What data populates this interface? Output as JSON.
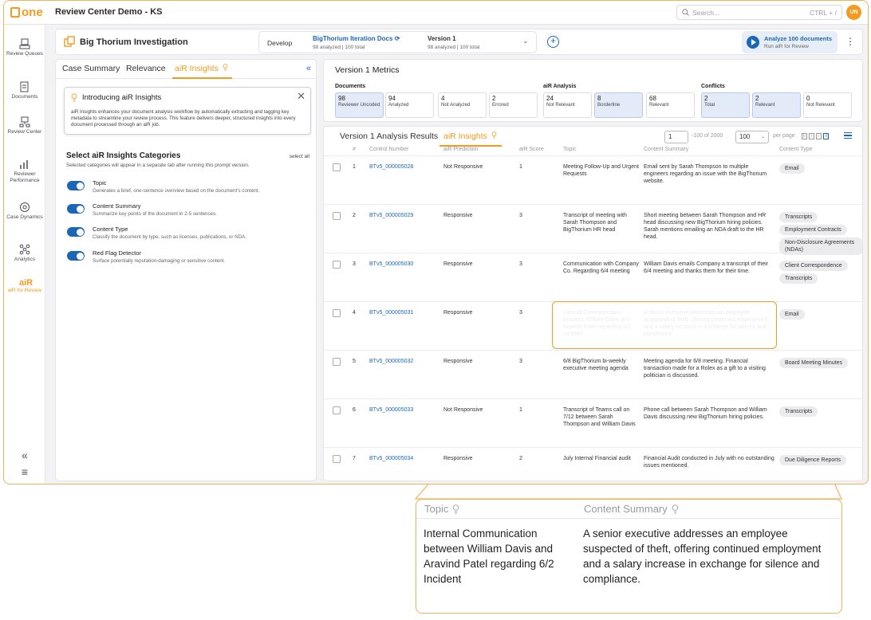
{
  "app": {
    "logo": "one",
    "title": "Review Center Demo - KS",
    "search_placeholder": "Search...",
    "search_shortcut": "CTRL + /",
    "avatar_initials": "UN"
  },
  "rail": [
    {
      "label": "Review Queues",
      "icon": "review-queues-icon"
    },
    {
      "label": "Documents",
      "icon": "documents-icon"
    },
    {
      "label": "Review Center",
      "icon": "review-center-icon"
    },
    {
      "label": "Reviewer Performance",
      "icon": "reviewer-performance-icon"
    },
    {
      "label": "Case Dynamics",
      "icon": "case-dynamics-icon"
    },
    {
      "label": "Analytics",
      "icon": "analytics-icon"
    },
    {
      "label": "aiR for Review",
      "icon": "air-icon"
    }
  ],
  "case": {
    "title": "Big Thorium Investigation",
    "env_label": "Develop",
    "prompt_link": "BigThorium Iteration Docs",
    "prompt_sub": "98 analyzed | 100 total",
    "version": "Version 1",
    "version_sub": "98 analyzed | 100 total",
    "analyze_label": "Analyze 100 documents",
    "analyze_sub": "Run aiR for Review"
  },
  "left_panel": {
    "tabs": [
      "Case Summary",
      "Relevance",
      "aiR Insights"
    ],
    "intro_title": "Introducing aiR Insights",
    "intro_text": "aiR Insights enhances your document analysis workflow by automatically extracting and tagging key metadata to streamline your review process. This feature delivers deeper, structured insights into every document processed through an aiR job.",
    "select_title": "Select aiR Insights Categories",
    "select_all": "select all",
    "select_sub": "Selected categories will appear in a separate tab after running this prompt version.",
    "categories": [
      {
        "name": "Topic",
        "desc": "Generates a brief, one-sentence overview based on the document's content."
      },
      {
        "name": "Content Summary",
        "desc": "Summarize key points of the document in 2-5 sentences."
      },
      {
        "name": "Content Type",
        "desc": "Classify the document by type, such as licenses, publications, or NDA."
      },
      {
        "name": "Red Flag Detector",
        "desc": "Surface potentially reputation-damaging or sensitive content."
      }
    ]
  },
  "metrics": {
    "title": "Version 1 Metrics",
    "groups": [
      "Documents",
      "aiR Analysis",
      "Conflicts"
    ],
    "documents": [
      {
        "n": "98",
        "l": "Reviewer Uncoded"
      },
      {
        "n": "94",
        "l": "Analyzed"
      },
      {
        "n": "4",
        "l": "Not Analyzed"
      },
      {
        "n": "2",
        "l": "Errored"
      }
    ],
    "analysis": [
      {
        "n": "24",
        "l": "Not Relevant"
      },
      {
        "n": "8",
        "l": "Borderline"
      },
      {
        "n": "68",
        "l": "Relevant"
      }
    ],
    "conflicts": [
      {
        "n": "2",
        "l": "Total"
      },
      {
        "n": "2",
        "l": "Relevant"
      },
      {
        "n": "0",
        "l": "Not Relevant"
      }
    ]
  },
  "results": {
    "tabs": [
      "Version 1 Analysis Results",
      "aiR Insights"
    ],
    "page": "1",
    "of_total": "-100 of 2000",
    "page_size": "100",
    "per_page": "per page",
    "columns": [
      "#",
      "Control Number",
      "aiR Prediction",
      "aiR Score",
      "Topic",
      "Content Summary",
      "Content Type"
    ],
    "rows": [
      {
        "idx": "1",
        "id": "BTv5_000005028",
        "pred": "Not Responsive",
        "score": "1",
        "topic": "Meeting Follow-Up and Urgent Requests",
        "summary": "Email sent by Sarah Thompson to multiple engineers regarding an issue with the BigThorium website.",
        "types": [
          "Email"
        ]
      },
      {
        "idx": "2",
        "id": "BTv5_000005029",
        "pred": "Responsive",
        "score": "3",
        "topic": "Transcript of meeting with Sarah Thompson and BigThorium HR head",
        "summary": "Short meeting between Sarah Thompson and HR head discussing new BigThorium hiring policies. Sarah mentions emailing an NDA draft to the HR head.",
        "types": [
          "Transcripts",
          "Employment Contracts",
          "Non-Disclosure Agreements (NDAs)"
        ]
      },
      {
        "idx": "3",
        "id": "BTv5_000005030",
        "pred": "Responsive",
        "score": "3",
        "topic": "Communication with Company Co. Regarding 6/4 meeting",
        "summary": "William Davis emails Company a transcript of their 6/4 meeting and thanks them for their time.",
        "types": [
          "Client Correspondence",
          "Transcripts"
        ]
      },
      {
        "idx": "4",
        "id": "BTv5_000005031",
        "pred": "Responsive",
        "score": "3",
        "topic": "Internal Communication between William Davis and Aravind Patel regarding 6/2 Incident",
        "summary": "A senior executive addresses an employee suspected of theft, offering continued employment and a salary increase in exchange for silence and compliance.",
        "types": [
          "Email"
        ]
      },
      {
        "idx": "5",
        "id": "BTv5_000005032",
        "pred": "Responsive",
        "score": "3",
        "topic": "6/8 BigThorium bi-weekly executive meeting agenda",
        "summary": "Meeting agenda for 6/8 meeting. Financial transaction made for a Rolex as a gift to a visiting politician is discussed.",
        "types": [
          "Board Meeting Minutes"
        ]
      },
      {
        "idx": "6",
        "id": "BTv5_000005033",
        "pred": "Not Responsive",
        "score": "1",
        "topic": "Transcript of Teams call on 7/12 between Sarah Thompson and William Davis",
        "summary": "Phone call between Sarah Thompson and William Davis discussing new BigThorium hiring policies.",
        "types": [
          "Transcripts"
        ]
      },
      {
        "idx": "7",
        "id": "BTv5_000005034",
        "pred": "Responsive",
        "score": "2",
        "topic": "July Internal Financial audit",
        "summary": "Financial Audit conducted in July with no outstanding issues mentioned.",
        "types": [
          "Due Diligence Reports"
        ]
      }
    ]
  },
  "callout": {
    "col1": "Topic",
    "col2": "Content Summary",
    "topic": "Internal Communication between William Davis and Aravind Patel regarding 6/2 Incident",
    "summary": "A senior executive addresses an employee suspected of theft, offering continued employment and a salary increase in exchange for silence and compliance."
  },
  "colors": {
    "accent": "#f39a1f",
    "link": "#1c66b8",
    "highlight": "#e4ebf8"
  }
}
